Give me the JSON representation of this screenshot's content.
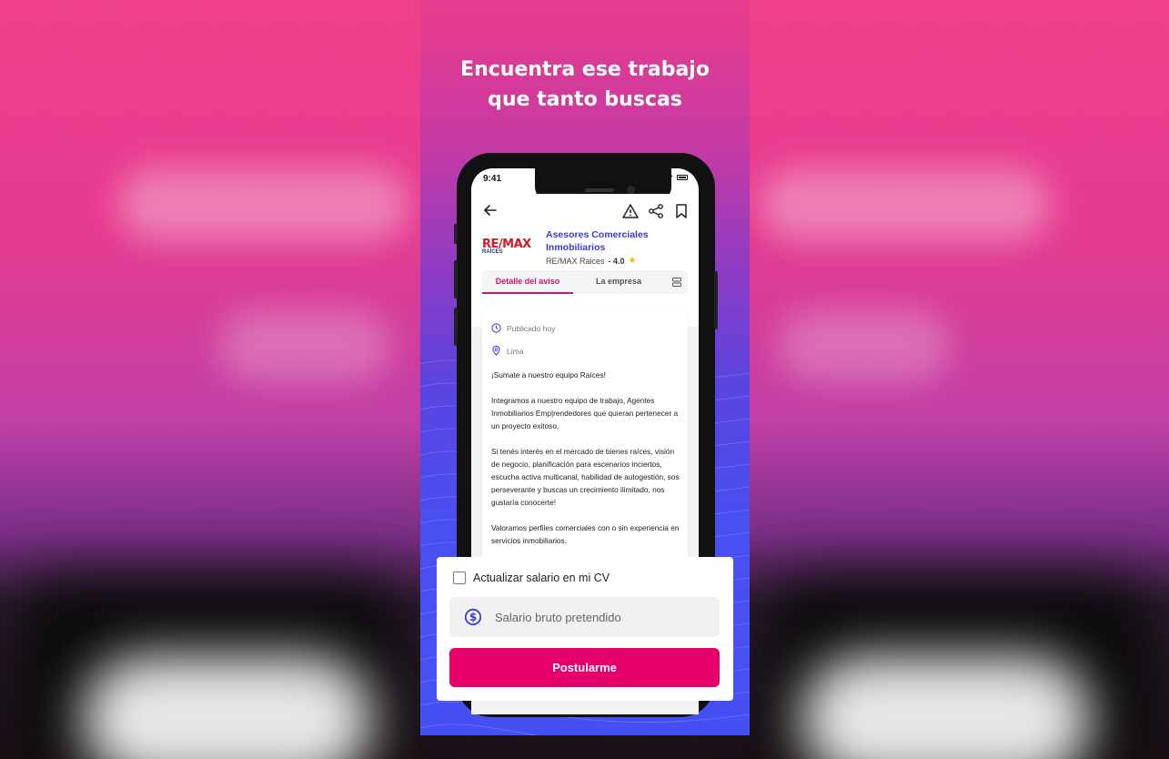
{
  "headline": {
    "line1": "Encuentra ese trabajo",
    "line2": "que tanto buscas"
  },
  "status": {
    "time": "9:41"
  },
  "toolbar": {
    "icons": [
      "back-arrow-icon",
      "report-warning-icon",
      "share-icon",
      "bookmark-icon"
    ]
  },
  "job": {
    "logo_text": "RE/MAX",
    "logo_sub": "RAÍCES",
    "title": "Asesores Comerciales Inmobiliarios",
    "company": "RE/MAX Raices",
    "rating": "- 4.0"
  },
  "tabs": [
    {
      "label": "Detalle del aviso",
      "active": true
    },
    {
      "label": "La empresa",
      "active": false
    }
  ],
  "details": {
    "published": "Publicado hoy",
    "location": "Lima",
    "paragraphs": [
      "¡Sumate a nuestro equipo Raíces!",
      "Integramos a nuestro equipo de trabajo, Agentes Inmobiliarios Emp|rendedores que quieran pertenecer a un proyecto exitoso.",
      "Si tenés interés en el mercado de bienes raíces, visión de negocio, planificación para escenarios inciertos, escucha activa multicanal, habilidad de autogestión, sos perseverante y buscas un crecimiento ilimitado, nos gustaría conocerte!",
      "Valoramos perfiles comerciales con o sin experiencia en servicios inmobiliarios."
    ]
  },
  "apply": {
    "checkbox_label": "Actualizar salario en mi CV",
    "checkbox_checked": false,
    "salary_placeholder": "Salario bruto pretendido",
    "salary_value": "",
    "button_label": "Postularme"
  },
  "colors": {
    "accent": "#e5006b",
    "link": "#3b3bd1",
    "tab_active": "#c8186e"
  }
}
